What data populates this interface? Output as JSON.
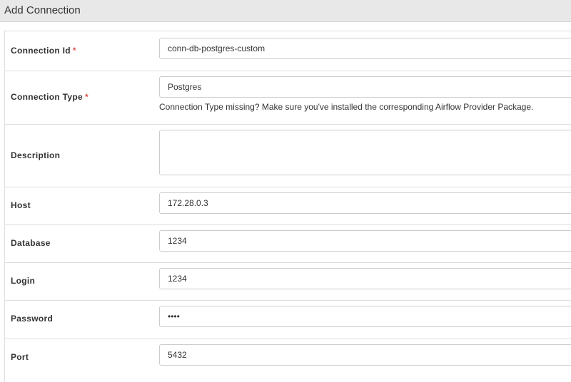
{
  "panel": {
    "title": "Add Connection"
  },
  "form": {
    "required_marker": "*",
    "connection_id": {
      "label": "Connection Id",
      "value": "conn-db-postgres-custom"
    },
    "connection_type": {
      "label": "Connection Type",
      "value": "Postgres",
      "help": "Connection Type missing? Make sure you've installed the corresponding Airflow Provider Package."
    },
    "description": {
      "label": "Description",
      "value": ""
    },
    "host": {
      "label": "Host",
      "value": "172.28.0.3"
    },
    "database": {
      "label": "Database",
      "value": "1234"
    },
    "login": {
      "label": "Login",
      "value": "1234"
    },
    "password": {
      "label": "Password",
      "value": "••••"
    },
    "port": {
      "label": "Port",
      "value": "5432"
    }
  }
}
